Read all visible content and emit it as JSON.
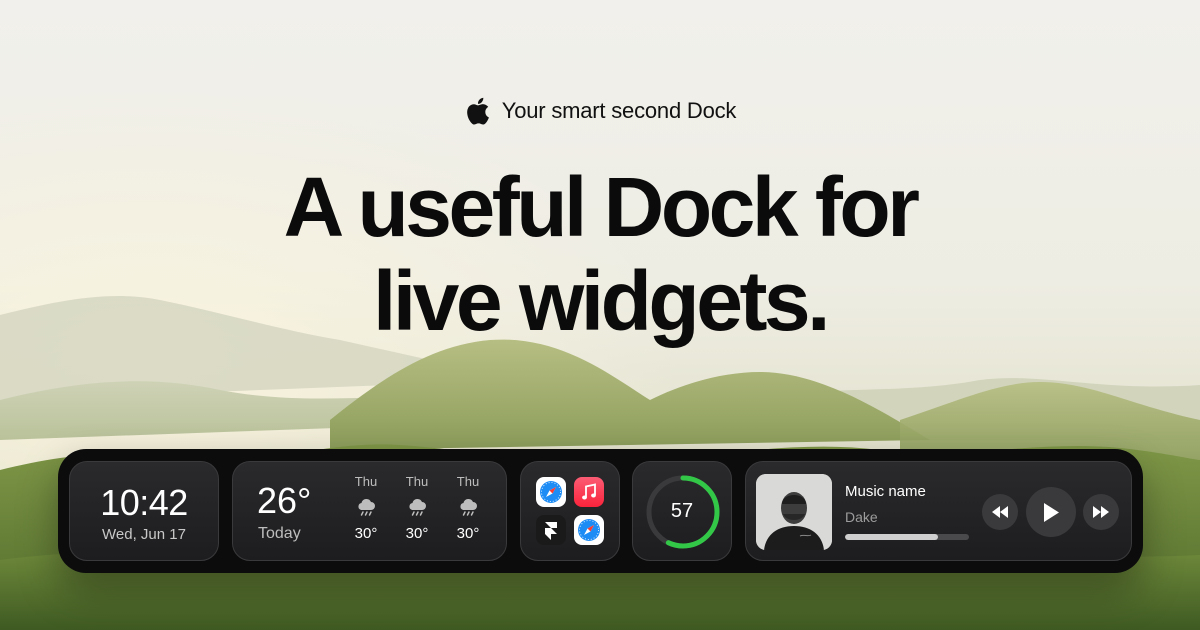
{
  "hero": {
    "eyebrow": "Your smart second Dock",
    "headline_line1": "A useful Dock for",
    "headline_line2": "live widgets."
  },
  "icons": {
    "brand": "apple-logo-icon",
    "weather": "rain-cloud-icon",
    "apps": [
      "safari-icon",
      "music-icon",
      "framer-icon",
      "safari-icon"
    ],
    "music_controls": [
      "rewind-icon",
      "play-icon",
      "fast-forward-icon"
    ]
  },
  "dock": {
    "clock": {
      "time": "10:42",
      "date": "Wed, Jun 17"
    },
    "weather": {
      "temp": "26°",
      "label": "Today",
      "forecast": [
        {
          "day": "Thu",
          "temp": "30°"
        },
        {
          "day": "Thu",
          "temp": "30°"
        },
        {
          "day": "Thu",
          "temp": "30°"
        }
      ]
    },
    "ring": {
      "value": "57",
      "fraction": 0.57,
      "color": "#33c748"
    },
    "music": {
      "title": "Music name",
      "artist": "Dake",
      "progress": 0.75
    }
  },
  "colors": {
    "accent_green": "#33c748",
    "dock_bg": "#0c0c0d",
    "widget_bg": "#2a2a2c",
    "music_app": "#fa2d48",
    "safari_blue": "#1e8cf5"
  }
}
